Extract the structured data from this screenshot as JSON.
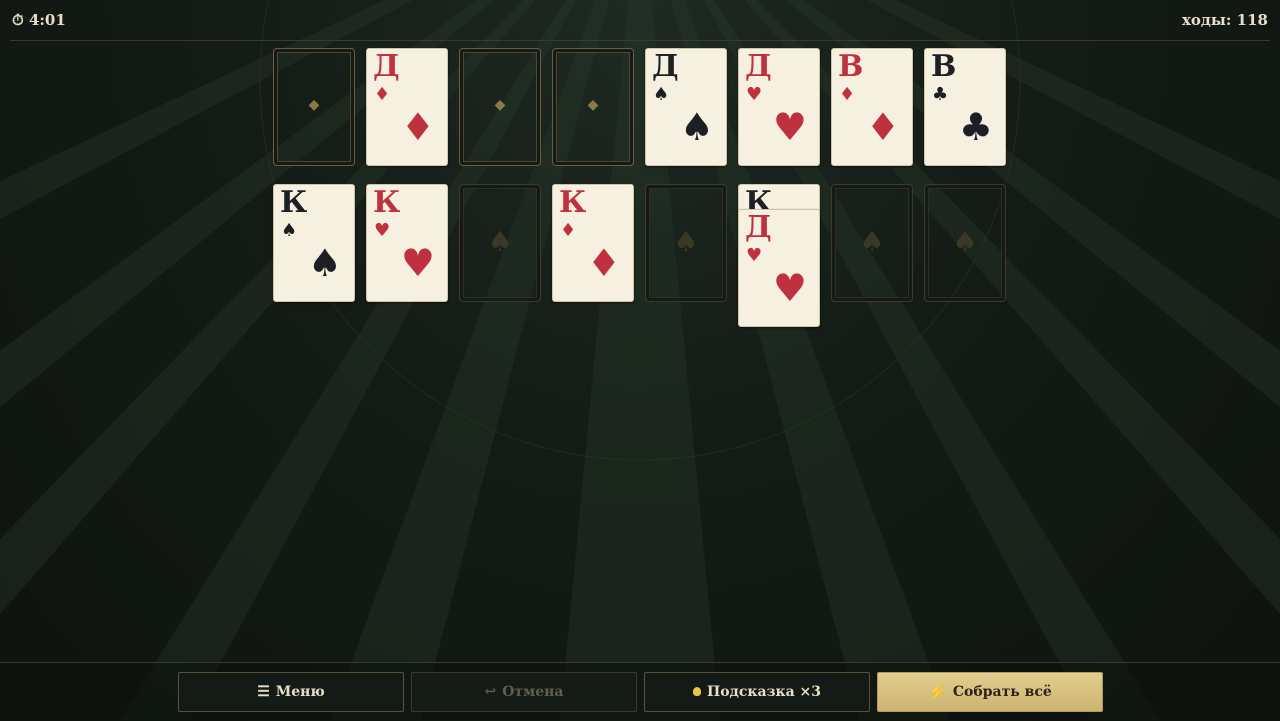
{
  "header": {
    "timer": "4:01",
    "moves": "ходы: 118"
  },
  "foundations": [
    {
      "type": "empty"
    },
    {
      "type": "card",
      "rank": "Д",
      "suit": "♦",
      "color": "red"
    },
    {
      "type": "empty"
    },
    {
      "type": "empty"
    }
  ],
  "top_cards": [
    {
      "rank": "Д",
      "suit": "♠",
      "color": "black"
    },
    {
      "rank": "Д",
      "suit": "♥",
      "color": "red"
    },
    {
      "rank": "В",
      "suit": "♦",
      "color": "red"
    },
    {
      "rank": "В",
      "suit": "♣",
      "color": "black"
    }
  ],
  "tableau": [
    {
      "type": "card",
      "rank": "К",
      "suit": "♠",
      "color": "black"
    },
    {
      "type": "card",
      "rank": "К",
      "suit": "♥",
      "color": "red"
    },
    {
      "type": "empty"
    },
    {
      "type": "card",
      "rank": "К",
      "suit": "♦",
      "color": "red"
    },
    {
      "type": "empty"
    },
    {
      "type": "stack",
      "under_rank": "К",
      "rank": "Д",
      "suit": "♥",
      "color": "red"
    },
    {
      "type": "empty"
    },
    {
      "type": "empty"
    }
  ],
  "symbols": {
    "foundation_mark": "◆",
    "cell_mark": "♠"
  },
  "buttons": {
    "menu": "Меню",
    "undo": "Отмена",
    "hint": "Подсказка ×3",
    "collect": "Собрать всё"
  },
  "icons": {
    "timer": "stopwatch-icon",
    "menu": "hamburger-icon",
    "undo": "undo-arrow-icon",
    "hint": "lightbulb-icon",
    "collect": "lightning-icon"
  },
  "colors": {
    "red_suit": "#c0313f",
    "black_suit": "#1d1f22",
    "card_face": "#f5f0e0",
    "gold_button": "#d8c17f",
    "felt": "#141b16"
  }
}
